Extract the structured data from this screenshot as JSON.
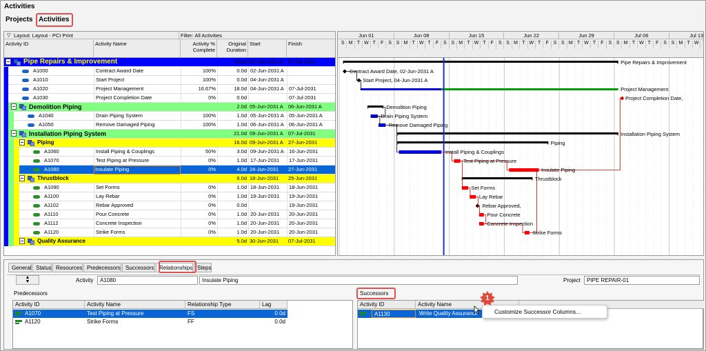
{
  "window": {
    "title": "Activities"
  },
  "main_tabs": [
    {
      "label": "Projects"
    },
    {
      "label": "Activities"
    }
  ],
  "grid": {
    "layout": "Layout: Layout - PCI Print",
    "filter": "Filter: All Activities",
    "columns": [
      "Activity ID",
      "Activity Name",
      "Activity % Complete",
      "Original Duration",
      "Start",
      "Finish"
    ],
    "rows": [
      {
        "kind": "wbs1",
        "id": "Pipe Repairs & Improvement",
        "name": "",
        "pct": "",
        "dur": "25.0d",
        "start": "02-Jun-2031 A",
        "finish": "07-Jul-2031"
      },
      {
        "kind": "act",
        "id": "A1000",
        "name": "Contract Award Date",
        "pct": "100%",
        "dur": "0.0d",
        "start": "02-Jun-2031 A",
        "finish": ""
      },
      {
        "kind": "act",
        "id": "A1010",
        "name": "Start Project",
        "pct": "100%",
        "dur": "0.0d",
        "start": "04-Jun-2031 A",
        "finish": ""
      },
      {
        "kind": "act",
        "id": "A1020",
        "name": "Project Management",
        "pct": "16.67%",
        "dur": "18.0d",
        "start": "04-Jun-2031 A",
        "finish": "07-Jul-2031"
      },
      {
        "kind": "act",
        "id": "A1030",
        "name": "Project Completion Date",
        "pct": "0%",
        "dur": "0.0d",
        "start": "",
        "finish": "07-Jul-2031"
      },
      {
        "kind": "wbs2",
        "id": "Demolition Piping",
        "name": "",
        "pct": "",
        "dur": "2.0d",
        "start": "05-Jun-2031 A",
        "finish": "06-Jun-2031 A"
      },
      {
        "kind": "act2",
        "id": "A1040",
        "name": "Drain Piping System",
        "pct": "100%",
        "dur": "1.0d",
        "start": "05-Jun-2031 A",
        "finish": "05-Jun-2031 A"
      },
      {
        "kind": "act2",
        "id": "A1050",
        "name": "Remove Damaged Piping",
        "pct": "100%",
        "dur": "1.0d",
        "start": "06-Jun-2031 A",
        "finish": "06-Jun-2031 A"
      },
      {
        "kind": "wbs2",
        "id": "Installation Piping System",
        "name": "",
        "pct": "",
        "dur": "21.0d",
        "start": "09-Jun-2031 A",
        "finish": "07-Jul-2031"
      },
      {
        "kind": "wbs3",
        "id": "Piping",
        "name": "",
        "pct": "",
        "dur": "16.0d",
        "start": "09-Jun-2031 A",
        "finish": "27-Jun-2031"
      },
      {
        "kind": "act3",
        "id": "A1060",
        "name": "Install Piping & Couplings",
        "pct": "50%",
        "dur": "3.0d",
        "start": "09-Jun-2031 A",
        "finish": "16-Jun-2031"
      },
      {
        "kind": "act3",
        "id": "A1070",
        "name": "Test Piping at Pressure",
        "pct": "0%",
        "dur": "1.0d",
        "start": "17-Jun-2031",
        "finish": "17-Jun-2031"
      },
      {
        "kind": "sel",
        "id": "A1080",
        "name": "Insulate Piping",
        "pct": "0%",
        "dur": "4.0d",
        "start": "24-Jun-2031",
        "finish": "27-Jun-2031"
      },
      {
        "kind": "wbs3",
        "id": "Thrustblock",
        "name": "",
        "pct": "",
        "dur": "6.0d",
        "start": "18-Jun-2031",
        "finish": "25-Jun-2031"
      },
      {
        "kind": "act3",
        "id": "A1090",
        "name": "Set Forms",
        "pct": "0%",
        "dur": "1.0d",
        "start": "18-Jun-2031",
        "finish": "18-Jun-2031"
      },
      {
        "kind": "act3",
        "id": "A1100",
        "name": "Lay Rebar",
        "pct": "0%",
        "dur": "1.0d",
        "start": "19-Jun-2031",
        "finish": "19-Jun-2031"
      },
      {
        "kind": "act3",
        "id": "A1102",
        "name": "Rebar Approved",
        "pct": "0%",
        "dur": "0.0d",
        "start": "",
        "finish": "19-Jun-2031"
      },
      {
        "kind": "act3",
        "id": "A1110",
        "name": "Pour Concrete",
        "pct": "0%",
        "dur": "1.0d",
        "start": "20-Jun-2031",
        "finish": "20-Jun-2031"
      },
      {
        "kind": "act3",
        "id": "A1112",
        "name": "Concrete Inspection",
        "pct": "0%",
        "dur": "1.0d",
        "start": "20-Jun-2031",
        "finish": "20-Jun-2031"
      },
      {
        "kind": "act3",
        "id": "A1120",
        "name": "Strike Forms",
        "pct": "0%",
        "dur": "1.0d",
        "start": "20-Jun-2031",
        "finish": "20-Jun-2031"
      },
      {
        "kind": "wbs3",
        "id": "Quality Assurance",
        "name": "",
        "pct": "",
        "dur": "5.0d",
        "start": "30-Jun-2031",
        "finish": "07-Jul-2031"
      }
    ]
  },
  "gantt": {
    "weeks": [
      "Jun 01",
      "Jun 08",
      "Jun 15",
      "Jun 22",
      "Jun 29",
      "Jul 06",
      "Jul 13"
    ],
    "day_letters": [
      "S",
      "M",
      "T",
      "W",
      "T",
      "F",
      "S"
    ],
    "labels": [
      "Pipe Repairs & Improvement",
      "Contract Award Date, 02-Jun-2031 A",
      "Start Project, 04-Jun-2031 A",
      "Project Management",
      "Project Completion Date,",
      "Demolition Piping",
      "Drain Piping System",
      "Remove Damaged Piping",
      "Installation Piping System",
      "Piping",
      "Install Piping & Couplings",
      "Test Piping at Pressure",
      "Insulate Piping",
      "Thrustblock",
      "Set Forms",
      "Lay Rebar",
      "Rebar Approved,",
      "Pour Concrete",
      "Concrete Inspection",
      "Strike Forms"
    ]
  },
  "bottom": {
    "tabs": [
      "General",
      "Status",
      "Resources",
      "Predecessors",
      "Successors",
      "Relationships",
      "Steps"
    ],
    "activity_label": "Activity",
    "activity_id": "A1080",
    "activity_name": "Insulate Piping",
    "project_label": "Project",
    "project_value": "PIPE REPAIR-01",
    "predecessors": {
      "title": "Predecessors",
      "columns": [
        "Activity ID",
        "Activity Name",
        "Relationship Type",
        "Lag"
      ],
      "rows": [
        {
          "id": "A1070",
          "name": "Test Piping at Pressure",
          "type": "FS",
          "lag": "0.0d"
        },
        {
          "id": "A1120",
          "name": "Strike Forms",
          "type": "FF",
          "lag": "0.0d"
        }
      ]
    },
    "successors": {
      "title": "Successors",
      "columns": [
        "Activity ID",
        "Activity Name"
      ],
      "rows": [
        {
          "id": "A1130",
          "name": "Write Quality Assurance"
        }
      ]
    }
  },
  "context_menu": {
    "item": "Customize Successor Columns..."
  },
  "callout": {
    "number": "1"
  },
  "colors": {
    "wbs1": "#0000ff",
    "wbs2": "#80ff80",
    "wbs3": "#ffff00",
    "selected": "#0a66d6",
    "bar_red": "#ff0000",
    "bar_green": "#00a000",
    "bar_blue": "#0000e0",
    "highlight": "#e05050"
  }
}
